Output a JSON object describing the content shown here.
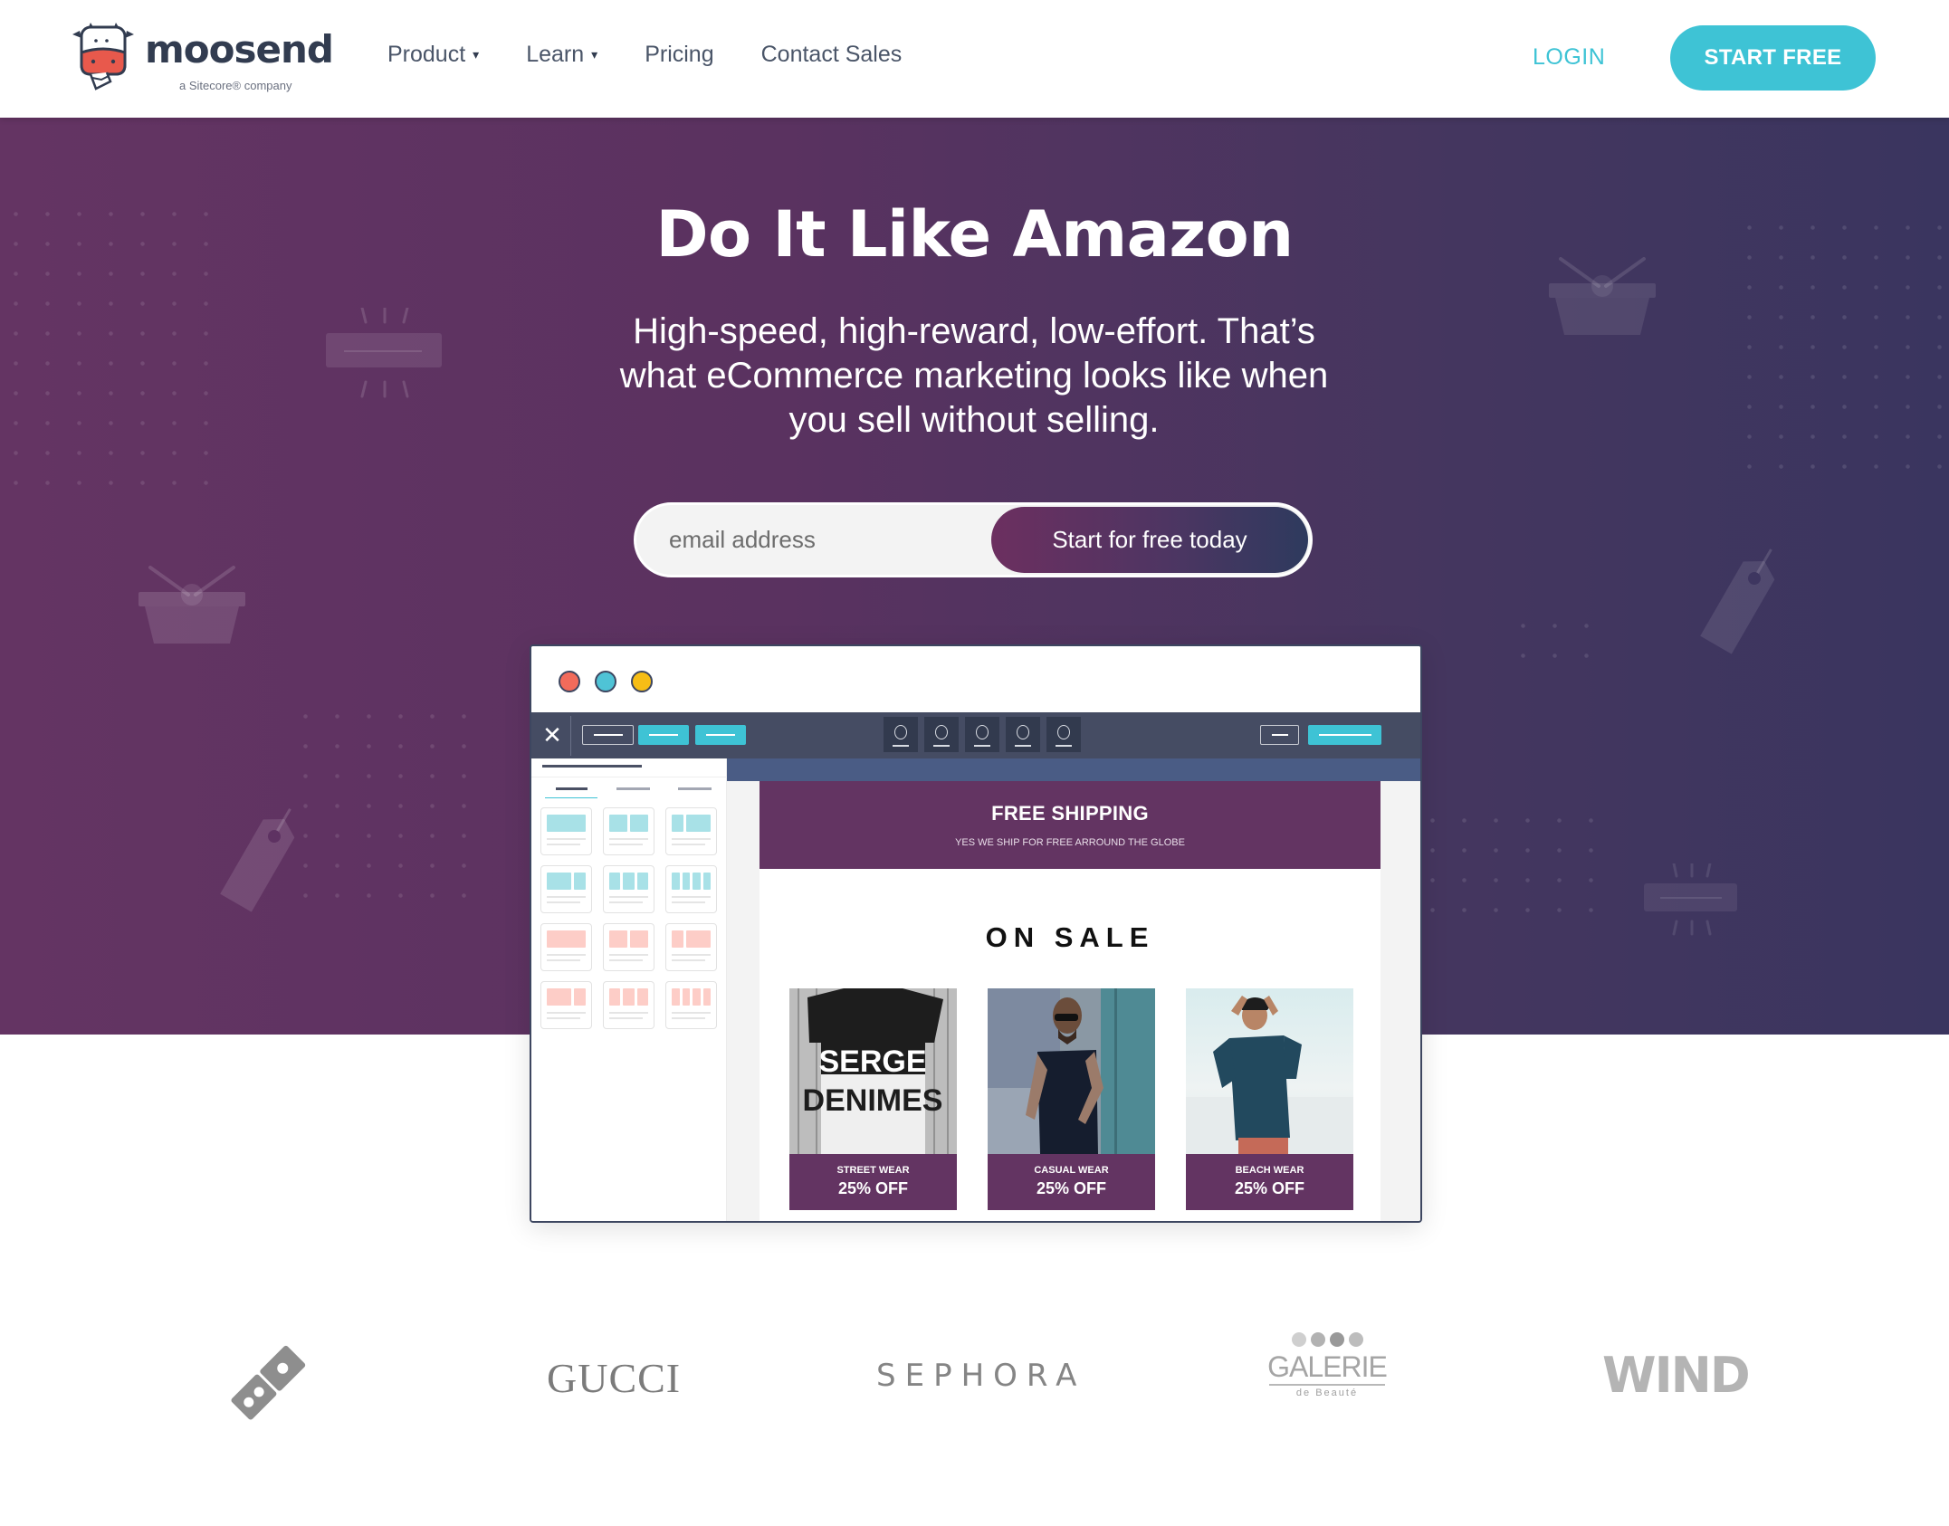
{
  "header": {
    "logo_text": "moosend",
    "logo_sub": "a Sitecore® company",
    "nav": [
      {
        "label": "Product",
        "has_dropdown": true
      },
      {
        "label": "Learn",
        "has_dropdown": true
      },
      {
        "label": "Pricing",
        "has_dropdown": false
      },
      {
        "label": "Contact Sales",
        "has_dropdown": false
      }
    ],
    "caret": "▾",
    "login_label": "LOGIN",
    "start_free_label": "START FREE"
  },
  "hero": {
    "title": "Do It Like Amazon",
    "subtitle_lines": [
      "High-speed, high-reward, low-effort. That’s",
      "what eCommerce marketing looks like when",
      "you sell without selling."
    ],
    "email_placeholder": "email address",
    "email_value": "",
    "cta_label": "Start for free today"
  },
  "mockup": {
    "traffic_lights": [
      {
        "name": "close",
        "color": "#f26b5b"
      },
      {
        "name": "minimize",
        "color": "#4fc3d6"
      },
      {
        "name": "maximize",
        "color": "#f6bd16"
      }
    ],
    "close_glyph": "✕",
    "toolbar_icon_count": 5,
    "block_palette": {
      "rows": [
        {
          "color": "#a8e1e7",
          "layouts": [
            [
              1
            ],
            [
              1,
              1
            ],
            [
              1,
              2
            ]
          ]
        },
        {
          "color": "#a8e1e7",
          "layouts": [
            [
              2,
              1
            ],
            [
              1,
              1,
              1
            ],
            [
              1,
              1,
              1,
              1
            ]
          ]
        },
        {
          "color": "#fdcdc7",
          "layouts": [
            [
              1
            ],
            [
              1,
              1
            ],
            [
              1,
              2
            ]
          ]
        },
        {
          "color": "#fdcdc7",
          "layouts": [
            [
              2,
              1
            ],
            [
              1,
              1,
              1
            ],
            [
              1,
              1,
              1,
              1
            ]
          ]
        }
      ]
    },
    "email": {
      "banner_title": "FREE SHIPPING",
      "banner_subtitle": "YES WE SHIP FOR FREE ARROUND THE GLOBE",
      "section_title": "ON SALE",
      "products": [
        {
          "category": "STREET WEAR",
          "discount": "25% OFF",
          "image_caption": [
            "SERGE",
            "DENIMES"
          ]
        },
        {
          "category": "CASUAL WEAR",
          "discount": "25% OFF"
        },
        {
          "category": "BEACH WEAR",
          "discount": "25% OFF"
        }
      ]
    }
  },
  "brands": {
    "gucci": "GUCCI",
    "sephora": "SEPHORA",
    "galerie_name": "GALERIE",
    "galerie_sub": "de Beauté",
    "wind": "WIND"
  },
  "colors": {
    "accent": "#3ec3d5",
    "brand_purple": "#633462",
    "navy": "#323c50"
  }
}
